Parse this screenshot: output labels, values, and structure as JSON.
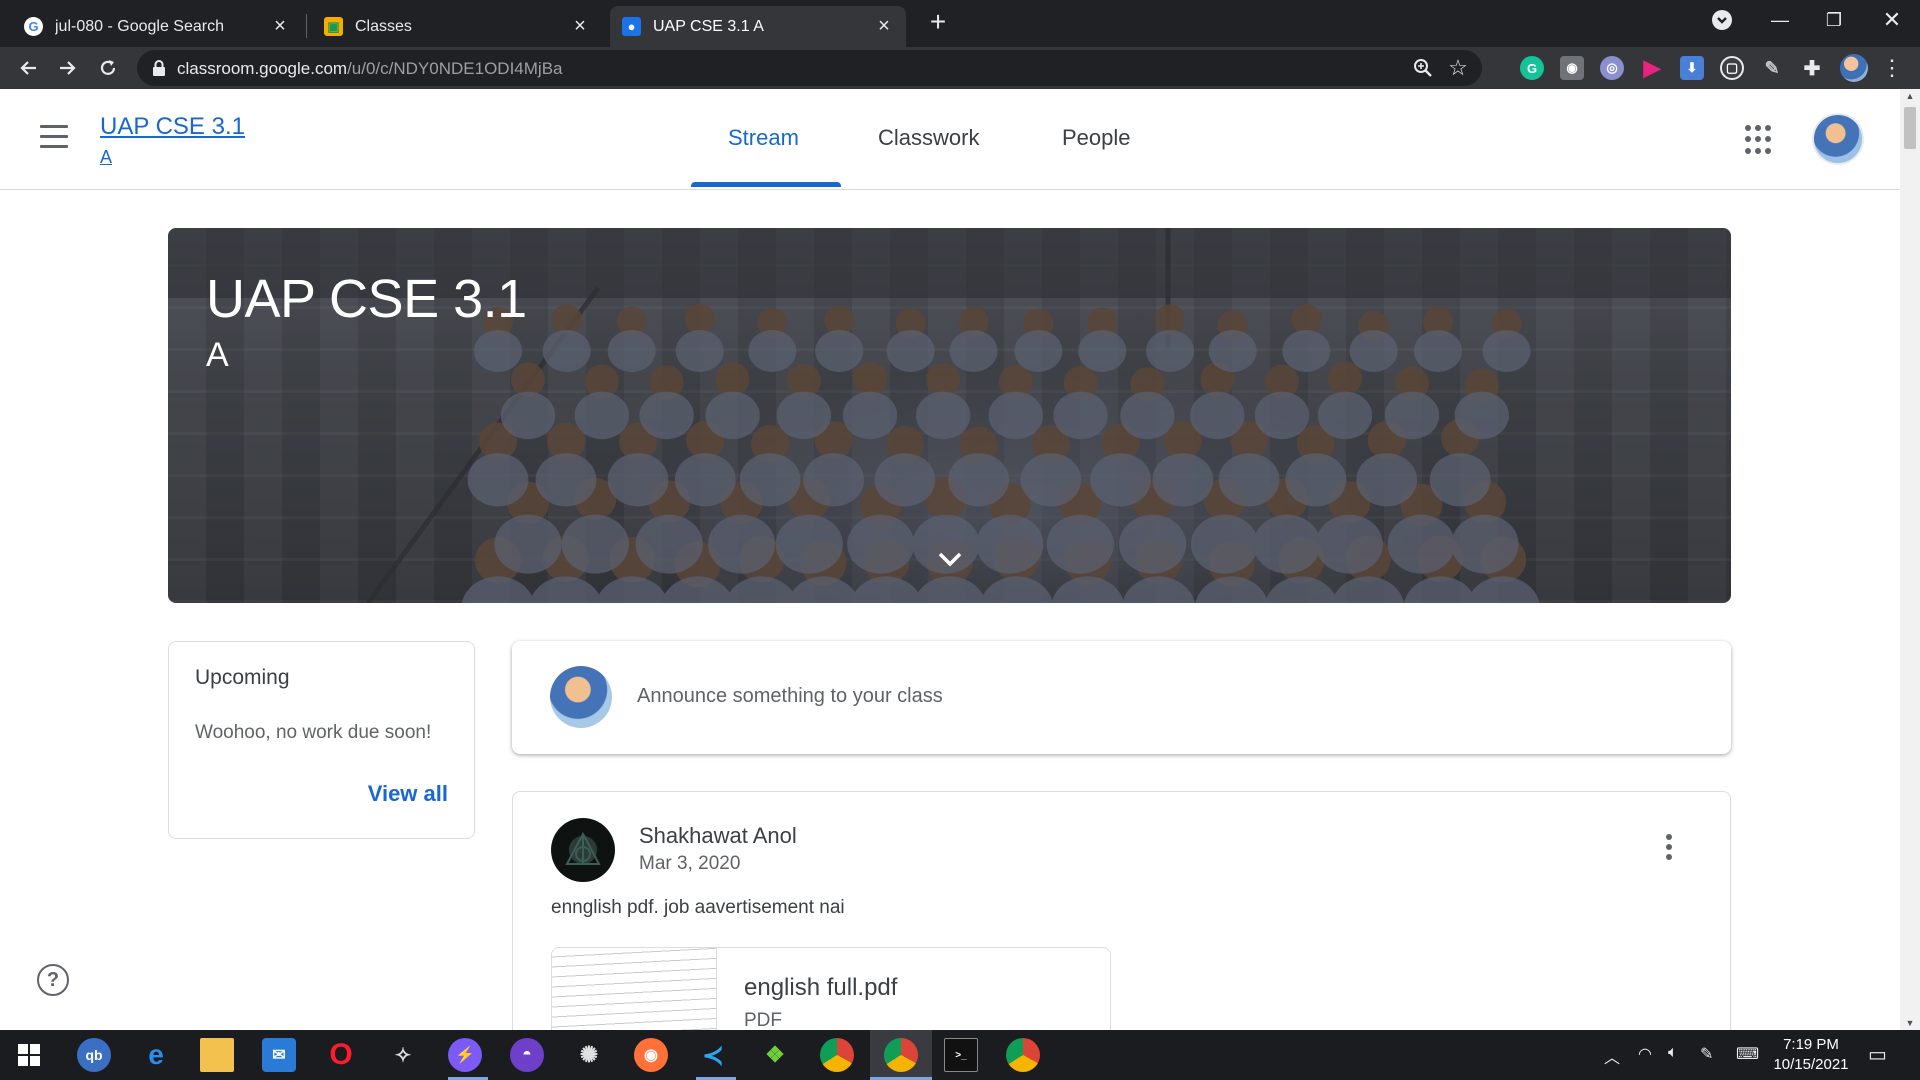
{
  "browser": {
    "tabs": [
      {
        "title": "jul-080 - Google Search",
        "favicon": "google-icon",
        "active": false
      },
      {
        "title": "Classes",
        "favicon": "classroom-icon",
        "active": false
      },
      {
        "title": "UAP CSE 3.1 A",
        "favicon": "classroom-person-icon",
        "active": true
      }
    ],
    "url_host": "classroom.google.com",
    "url_path": "/u/0/c/NDY0NDE1ODI4MjBa"
  },
  "header": {
    "class_title": "UAP CSE 3.1",
    "class_section": "A",
    "tabs": [
      "Stream",
      "Classwork",
      "People"
    ],
    "active_tab": "Stream"
  },
  "banner": {
    "title": "UAP CSE 3.1",
    "section": "A"
  },
  "upcoming": {
    "title": "Upcoming",
    "empty_text": "Woohoo, no work due soon!",
    "view_all": "View all"
  },
  "announce": {
    "placeholder": "Announce something to your class"
  },
  "post": {
    "author": "Shakhawat Anol",
    "date": "Mar 3, 2020",
    "body": "ennglish pdf. job aavertisement nai",
    "attachment": {
      "name": "english full.pdf",
      "type": "PDF"
    }
  },
  "taskbar": {
    "time": "7:19 PM",
    "date": "10/15/2021"
  },
  "colors": {
    "accent": "#1967d2",
    "chrome_dark": "#202124",
    "toolbar": "#35363a"
  }
}
